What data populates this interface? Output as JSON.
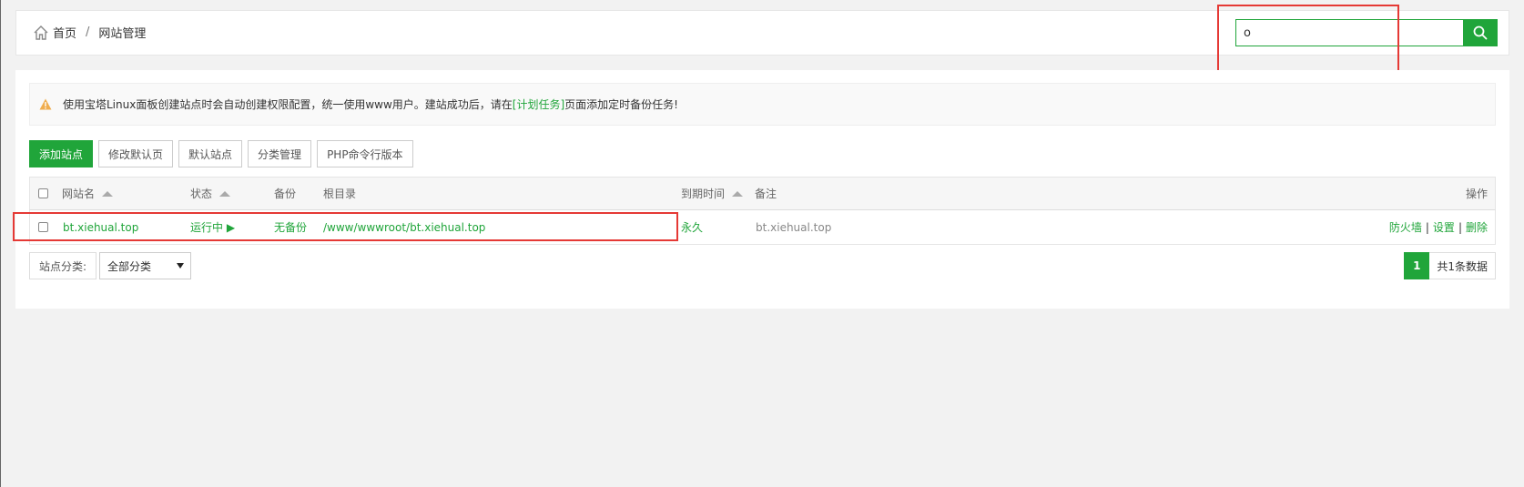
{
  "breadcrumb": {
    "home": "首页",
    "separator": "/",
    "current": "网站管理"
  },
  "search": {
    "value": "o"
  },
  "notice": {
    "text_before": "使用宝塔Linux面板创建站点时会自动创建权限配置，统一使用www用户。建站成功后，请在",
    "link": "[计划任务]",
    "text_after": "页面添加定时备份任务!"
  },
  "toolbar": {
    "add_site": "添加站点",
    "edit_default_page": "修改默认页",
    "default_site": "默认站点",
    "category_manage": "分类管理",
    "php_cli_version": "PHP命令行版本"
  },
  "table": {
    "headers": {
      "name": "网站名",
      "status": "状态",
      "backup": "备份",
      "root": "根目录",
      "expire": "到期时间",
      "remark": "备注",
      "actions": "操作"
    },
    "rows": [
      {
        "name": "bt.xiehual.top",
        "status": "运行中 ▶",
        "backup": "无备份",
        "root": "/www/wwwroot/bt.xiehual.top",
        "expire": "永久",
        "remark": "bt.xiehual.top",
        "firewall": "防火墙",
        "settings": "设置",
        "delete": "删除",
        "divider": "|"
      }
    ]
  },
  "footer": {
    "category_label": "站点分类:",
    "category_value": "全部分类",
    "page": "1",
    "total": "共1条数据"
  },
  "colors": {
    "accent": "#20a53a",
    "highlight": "#e53935"
  }
}
